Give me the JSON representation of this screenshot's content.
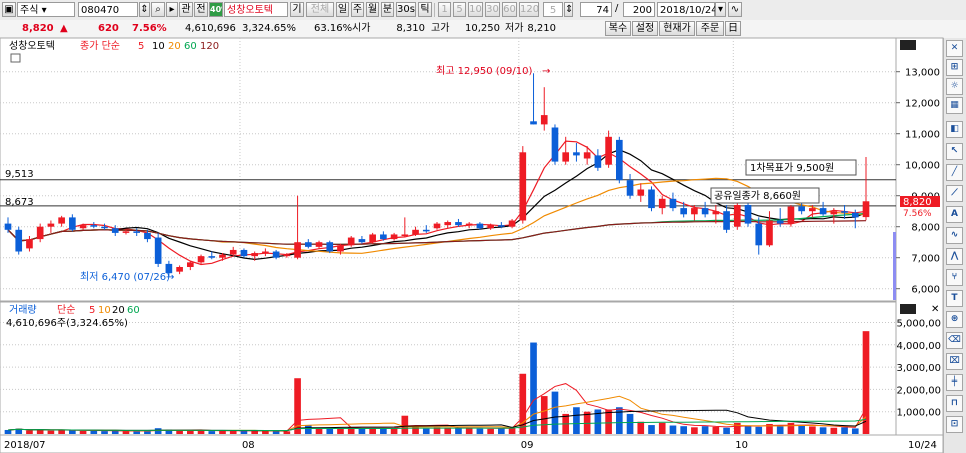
{
  "toolbar": {
    "mode": "주식",
    "code": "080470",
    "tab_related": "관",
    "tab_all": "전",
    "badge": "40%",
    "name": "성창오토텍",
    "period_label": "기",
    "btn_all": "전체",
    "periods": [
      "일",
      "주",
      "월",
      "분",
      "30s",
      "틱"
    ],
    "intervals": [
      "1",
      "5",
      "10",
      "30",
      "60",
      "120"
    ],
    "interval_value": "5",
    "count_value": "74",
    "slash": "/",
    "total_value": "200",
    "date_value": "2018/10/24"
  },
  "quote": {
    "price": "8,820",
    "change": "620",
    "rate": "7.56%",
    "volume": "4,610,696",
    "volume_rate": "3,324.65%",
    "turnover": "63.16%",
    "open_label": "시가",
    "open_value": "8,310",
    "high_label": "고가",
    "high_value": "10,250",
    "low_label": "저가",
    "low_value": "8,210",
    "btns": [
      "복수",
      "설정",
      "현재가",
      "주문",
      "日"
    ]
  },
  "chart_data": [
    {
      "type": "candlestick",
      "legend_name": "성창오토텍",
      "legend_ma": "종가 단순",
      "ma_periods": [
        "5",
        "10",
        "20",
        "60",
        "120"
      ],
      "ma_colors": [
        "#ee1b24",
        "#000000",
        "#f08a00",
        "#00a651",
        "#8b1a1a"
      ],
      "yticks": [
        "13,000",
        "12,000",
        "11,000",
        "10,000",
        "9,000",
        "8,000",
        "7,000",
        "6,000"
      ],
      "yvalues": [
        13000,
        12000,
        11000,
        10000,
        9000,
        8000,
        7000,
        6000
      ],
      "ylim": [
        5700,
        13700
      ],
      "xlabels": [
        "2018/07",
        "08",
        "09",
        "10",
        "10/24"
      ],
      "xlabel_index": [
        0,
        22,
        48,
        68,
        88
      ],
      "candles": [
        [
          8100,
          8300,
          7800,
          7900
        ],
        [
          7900,
          8000,
          7100,
          7200
        ],
        [
          7300,
          7700,
          7200,
          7600
        ],
        [
          7600,
          8100,
          7500,
          8000
        ],
        [
          8000,
          8200,
          7800,
          8100
        ],
        [
          8100,
          8350,
          8000,
          8300
        ],
        [
          8300,
          8400,
          7850,
          7900
        ],
        [
          7950,
          8100,
          7900,
          8050
        ],
        [
          8050,
          8150,
          7950,
          8000
        ],
        [
          8000,
          8100,
          7900,
          7950
        ],
        [
          7950,
          8050,
          7700,
          7800
        ],
        [
          7800,
          7900,
          7750,
          7850
        ],
        [
          7850,
          7950,
          7700,
          7800
        ],
        [
          7800,
          7900,
          7500,
          7600
        ],
        [
          7650,
          7800,
          6700,
          6800
        ],
        [
          6800,
          6900,
          6400,
          6500
        ],
        [
          6550,
          6750,
          6470,
          6700
        ],
        [
          6700,
          6900,
          6600,
          6850
        ],
        [
          6850,
          7100,
          6800,
          7050
        ],
        [
          7050,
          7200,
          6950,
          7000
        ],
        [
          7000,
          7150,
          6900,
          7100
        ],
        [
          7100,
          7350,
          7050,
          7250
        ],
        [
          7250,
          7300,
          7000,
          7050
        ],
        [
          7050,
          7200,
          6900,
          7150
        ],
        [
          7150,
          7300,
          7050,
          7200
        ],
        [
          7200,
          7250,
          6950,
          7000
        ],
        [
          7050,
          7150,
          7000,
          7100
        ],
        [
          7000,
          9000,
          6950,
          7500
        ],
        [
          7500,
          7600,
          7300,
          7350
        ],
        [
          7350,
          7550,
          7300,
          7500
        ],
        [
          7500,
          7550,
          7150,
          7200
        ],
        [
          7200,
          7450,
          7100,
          7400
        ],
        [
          7400,
          7700,
          7350,
          7650
        ],
        [
          7600,
          7700,
          7450,
          7500
        ],
        [
          7500,
          7800,
          7450,
          7750
        ],
        [
          7750,
          7850,
          7550,
          7600
        ],
        [
          7600,
          7800,
          7550,
          7750
        ],
        [
          7700,
          8300,
          7650,
          7750
        ],
        [
          7750,
          8000,
          7700,
          7900
        ],
        [
          7900,
          8050,
          7800,
          7850
        ],
        [
          7950,
          8150,
          7900,
          8100
        ],
        [
          8050,
          8200,
          7950,
          8150
        ],
        [
          8150,
          8250,
          8000,
          8050
        ],
        [
          8050,
          8150,
          7950,
          8100
        ],
        [
          8100,
          8150,
          7900,
          7950
        ],
        [
          7950,
          8100,
          7900,
          8050
        ],
        [
          8050,
          8150,
          7950,
          8000
        ],
        [
          8000,
          8250,
          7950,
          8200
        ],
        [
          8200,
          10600,
          8100,
          10400
        ],
        [
          11400,
          12950,
          11300,
          11300
        ],
        [
          11300,
          12500,
          11100,
          11600
        ],
        [
          11200,
          11300,
          10000,
          10100
        ],
        [
          10100,
          10900,
          10000,
          10400
        ],
        [
          10400,
          10700,
          10100,
          10300
        ],
        [
          10200,
          10600,
          10000,
          10400
        ],
        [
          10300,
          10500,
          9800,
          9900
        ],
        [
          10000,
          11100,
          9900,
          10900
        ],
        [
          10800,
          10900,
          9400,
          9500
        ],
        [
          9500,
          9700,
          8900,
          9000
        ],
        [
          9000,
          9400,
          8800,
          9200
        ],
        [
          9200,
          9300,
          8500,
          8600
        ],
        [
          8600,
          9000,
          8400,
          8900
        ],
        [
          8900,
          9100,
          8500,
          8600
        ],
        [
          8600,
          8800,
          8300,
          8400
        ],
        [
          8400,
          8700,
          8200,
          8600
        ],
        [
          8600,
          8800,
          8300,
          8400
        ],
        [
          8400,
          8700,
          8100,
          8500
        ],
        [
          8500,
          8700,
          7800,
          7900
        ],
        [
          8000,
          8800,
          7900,
          8700
        ],
        [
          8700,
          8900,
          8000,
          8100
        ],
        [
          8100,
          8300,
          7100,
          7400
        ],
        [
          7400,
          8500,
          7350,
          8200
        ],
        [
          8200,
          8600,
          8000,
          8100
        ],
        [
          8100,
          8700,
          8000,
          8650
        ],
        [
          8650,
          8750,
          8400,
          8500
        ],
        [
          8500,
          8700,
          8300,
          8600
        ],
        [
          8600,
          8800,
          8350,
          8400
        ],
        [
          8400,
          8600,
          8100,
          8500
        ],
        [
          8500,
          8700,
          8250,
          8450
        ],
        [
          8450,
          8550,
          7950,
          8300
        ],
        [
          8310,
          10250,
          8210,
          8820
        ]
      ],
      "annotations": {
        "high": "최고 12,950 (09/10)",
        "low": "최저 6,470 (07/26)",
        "target": "1차목표가  9,500원",
        "rights": "공유일종가  8,660원",
        "line_a": "9,513",
        "line_b": "8,673",
        "last_price": "8,820",
        "last_rate": "7.56%"
      }
    },
    {
      "type": "bar",
      "legend_name": "거래량",
      "legend_ma": "단순",
      "ma_periods": [
        "5",
        "10",
        "20",
        "60"
      ],
      "ma_colors": [
        "#ee1b24",
        "#f08a00",
        "#000000",
        "#00a651"
      ],
      "info": "4,610,696주(3,324.65%)",
      "yticks": [
        "5,000,00",
        "4,000,00",
        "3,000,00",
        "2,000,00",
        "1,000,00"
      ],
      "yvalues": [
        5000000,
        4000000,
        3000000,
        2000000,
        1000000
      ],
      "ylim": [
        0,
        5200000
      ],
      "values": [
        180000,
        240000,
        160000,
        200000,
        150000,
        160000,
        180000,
        140000,
        150000,
        130000,
        140000,
        120000,
        130000,
        150000,
        260000,
        200000,
        140000,
        150000,
        160000,
        130000,
        140000,
        150000,
        140000,
        130000,
        140000,
        130000,
        120000,
        2500000,
        380000,
        240000,
        250000,
        260000,
        300000,
        240000,
        260000,
        230000,
        240000,
        820000,
        350000,
        240000,
        300000,
        280000,
        260000,
        280000,
        240000,
        230000,
        260000,
        280000,
        2700000,
        4100000,
        1700000,
        1900000,
        900000,
        1200000,
        1000000,
        1100000,
        1100000,
        1200000,
        900000,
        550000,
        400000,
        500000,
        380000,
        350000,
        300000,
        350000,
        320000,
        280000,
        500000,
        360000,
        320000,
        450000,
        340000,
        500000,
        380000,
        340000,
        300000,
        280000,
        300000,
        250000,
        4610000
      ]
    }
  ],
  "colors": {
    "up": "#ee1b24",
    "down": "#0b5fd8",
    "grid": "#c8c8c8"
  }
}
